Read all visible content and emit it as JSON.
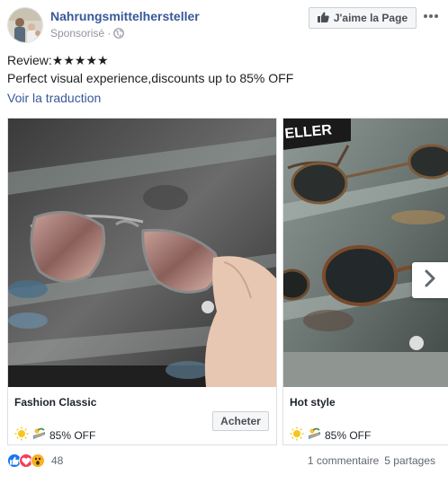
{
  "header": {
    "page_name": "Nahrungsmittelhersteller",
    "sponsored": "Sponsorisé ·",
    "like_page_label": "J'aime la Page",
    "more_icon": "more-horizontal-icon"
  },
  "post": {
    "line1": "Review:★★★★★",
    "line2": "Perfect visual experience,discounts up to 85% OFF",
    "translate_link": "Voir la traduction"
  },
  "carousel": {
    "cards": [
      {
        "title": "Fashion Classic",
        "subtitle": "85% OFF",
        "cta": "Acheter"
      },
      {
        "title": "Hot style",
        "subtitle": "85% OFF"
      }
    ]
  },
  "footer": {
    "reaction_count": "48",
    "comments": "1 commentaire",
    "shares": "5 partages"
  },
  "colors": {
    "link": "#385898",
    "like_blue": "#1877f2",
    "love_red": "#f33e58",
    "wow_yellow": "#f7b125"
  }
}
